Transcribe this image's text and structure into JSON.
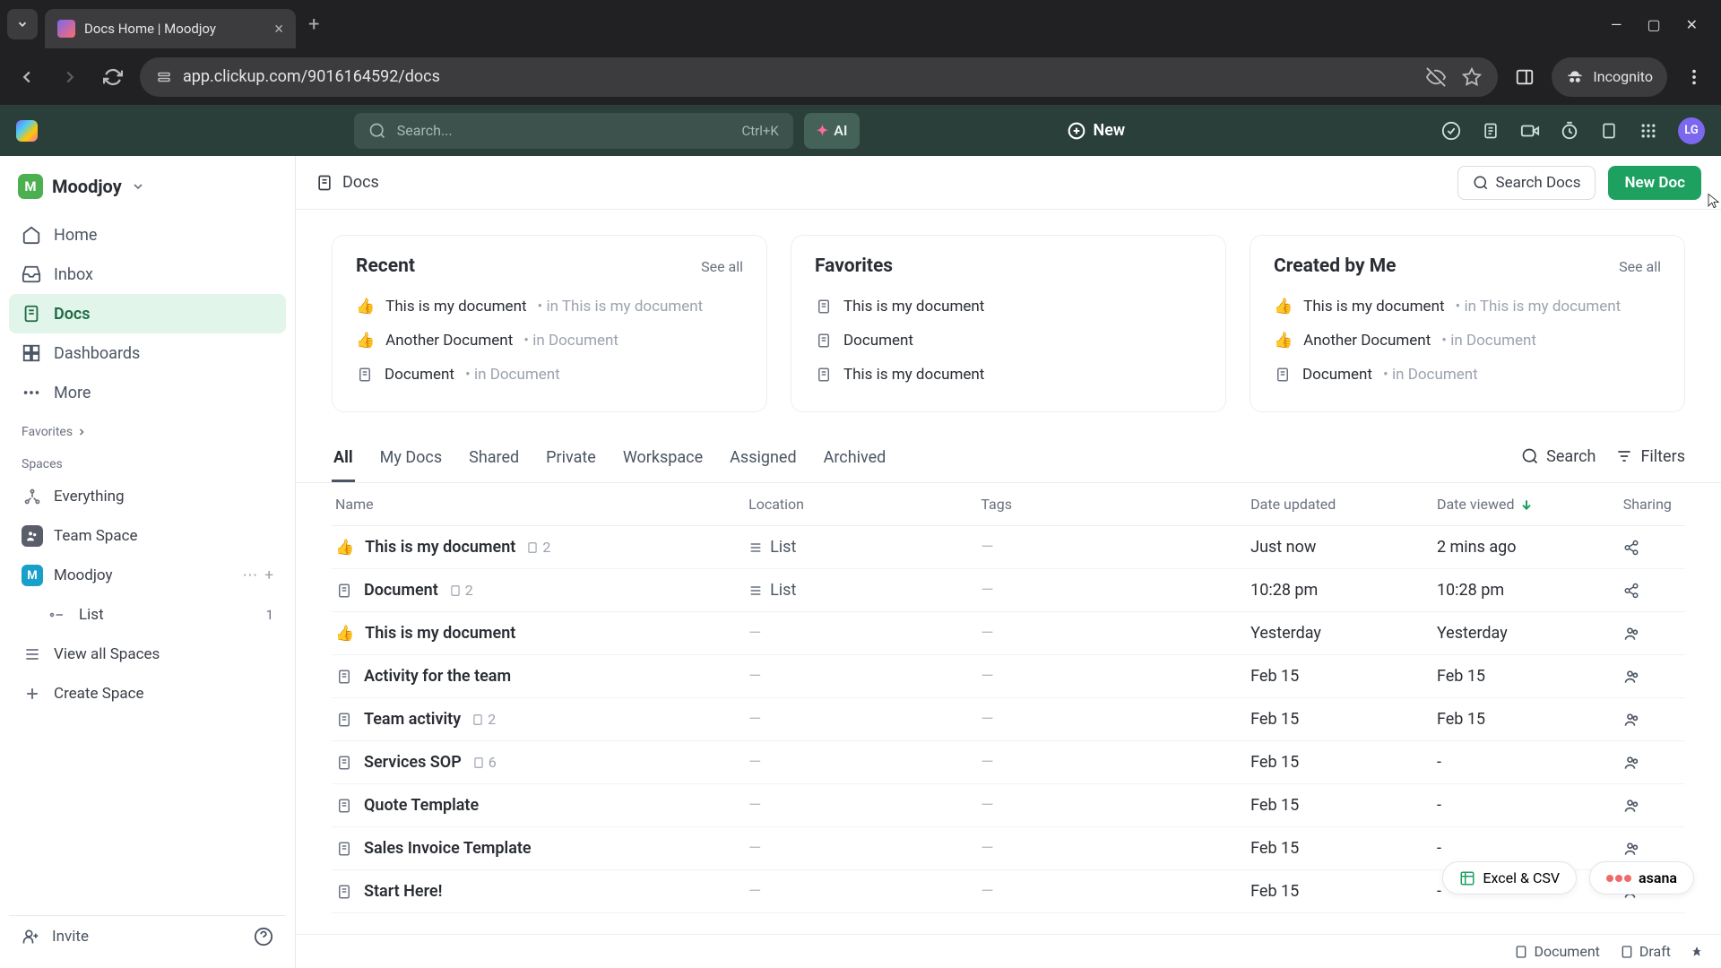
{
  "browser": {
    "tab_title": "Docs Home | Moodjoy",
    "url": "app.clickup.com/9016164592/docs",
    "incognito_label": "Incognito"
  },
  "appbar": {
    "search_placeholder": "Search...",
    "search_kbd": "Ctrl+K",
    "ai_label": "AI",
    "new_label": "New",
    "avatar_initials": "LG"
  },
  "workspace": {
    "badge_letter": "M",
    "name": "Moodjoy"
  },
  "sidebar": {
    "nav": [
      {
        "label": "Home"
      },
      {
        "label": "Inbox"
      },
      {
        "label": "Docs"
      },
      {
        "label": "Dashboards"
      },
      {
        "label": "More"
      }
    ],
    "favorites_label": "Favorites",
    "spaces_label": "Spaces",
    "spaces": {
      "everything": "Everything",
      "team_space": "Team Space",
      "moodjoy": "Moodjoy",
      "list": "List",
      "list_count": "1",
      "view_all": "View all Spaces",
      "create": "Create Space"
    },
    "invite_label": "Invite"
  },
  "header": {
    "breadcrumb": "Docs",
    "search_docs": "Search Docs",
    "new_doc": "New Doc"
  },
  "cards": {
    "recent": {
      "title": "Recent",
      "see_all": "See all",
      "items": [
        {
          "icon": "thumb",
          "name": "This is my document",
          "meta": "• in This is my document"
        },
        {
          "icon": "thumb",
          "name": "Another Document",
          "meta": "• in Document"
        },
        {
          "icon": "doc",
          "name": "Document",
          "meta": "• in Document"
        }
      ]
    },
    "favorites": {
      "title": "Favorites",
      "items": [
        {
          "icon": "doc",
          "name": "This is my document"
        },
        {
          "icon": "doc",
          "name": "Document"
        },
        {
          "icon": "doc",
          "name": "This is my document"
        }
      ]
    },
    "created": {
      "title": "Created by Me",
      "see_all": "See all",
      "items": [
        {
          "icon": "thumb",
          "name": "This is my document",
          "meta": "• in This is my document"
        },
        {
          "icon": "thumb",
          "name": "Another Document",
          "meta": "• in Document"
        },
        {
          "icon": "doc",
          "name": "Document",
          "meta": "• in Document"
        }
      ]
    }
  },
  "tabs": {
    "items": [
      "All",
      "My Docs",
      "Shared",
      "Private",
      "Workspace",
      "Assigned",
      "Archived"
    ],
    "search_label": "Search",
    "filters_label": "Filters"
  },
  "table": {
    "columns": {
      "name": "Name",
      "location": "Location",
      "tags": "Tags",
      "updated": "Date updated",
      "viewed": "Date viewed",
      "sharing": "Sharing"
    },
    "rows": [
      {
        "icon": "thumb",
        "name": "This is my document",
        "sub": "2",
        "loc": "List",
        "updated": "Just now",
        "viewed": "2 mins ago",
        "share": "share"
      },
      {
        "icon": "doc",
        "name": "Document",
        "sub": "2",
        "loc": "List",
        "updated": "10:28 pm",
        "viewed": "10:28 pm",
        "share": "share"
      },
      {
        "icon": "thumb",
        "name": "This is my document",
        "updated": "Yesterday",
        "viewed": "Yesterday",
        "share": "people"
      },
      {
        "icon": "doc",
        "name": "Activity for the team",
        "updated": "Feb 15",
        "viewed": "Feb 15",
        "share": "people"
      },
      {
        "icon": "doc",
        "name": "Team activity",
        "sub": "2",
        "updated": "Feb 15",
        "viewed": "Feb 15",
        "share": "people"
      },
      {
        "icon": "doc",
        "name": "Services SOP",
        "sub": "6",
        "updated": "Feb 15",
        "viewed": "-",
        "share": "people"
      },
      {
        "icon": "doc",
        "name": "Quote Template",
        "updated": "Feb 15",
        "viewed": "-",
        "share": "people"
      },
      {
        "icon": "doc",
        "name": "Sales Invoice Template",
        "updated": "Feb 15",
        "viewed": "-",
        "share": "people"
      },
      {
        "icon": "doc",
        "name": "Start Here!",
        "updated": "Feb 15",
        "viewed": "-",
        "share": "people"
      }
    ]
  },
  "float": {
    "excel": "Excel & CSV",
    "asana": "asana"
  },
  "bottom": {
    "document": "Document",
    "draft": "Draft"
  }
}
